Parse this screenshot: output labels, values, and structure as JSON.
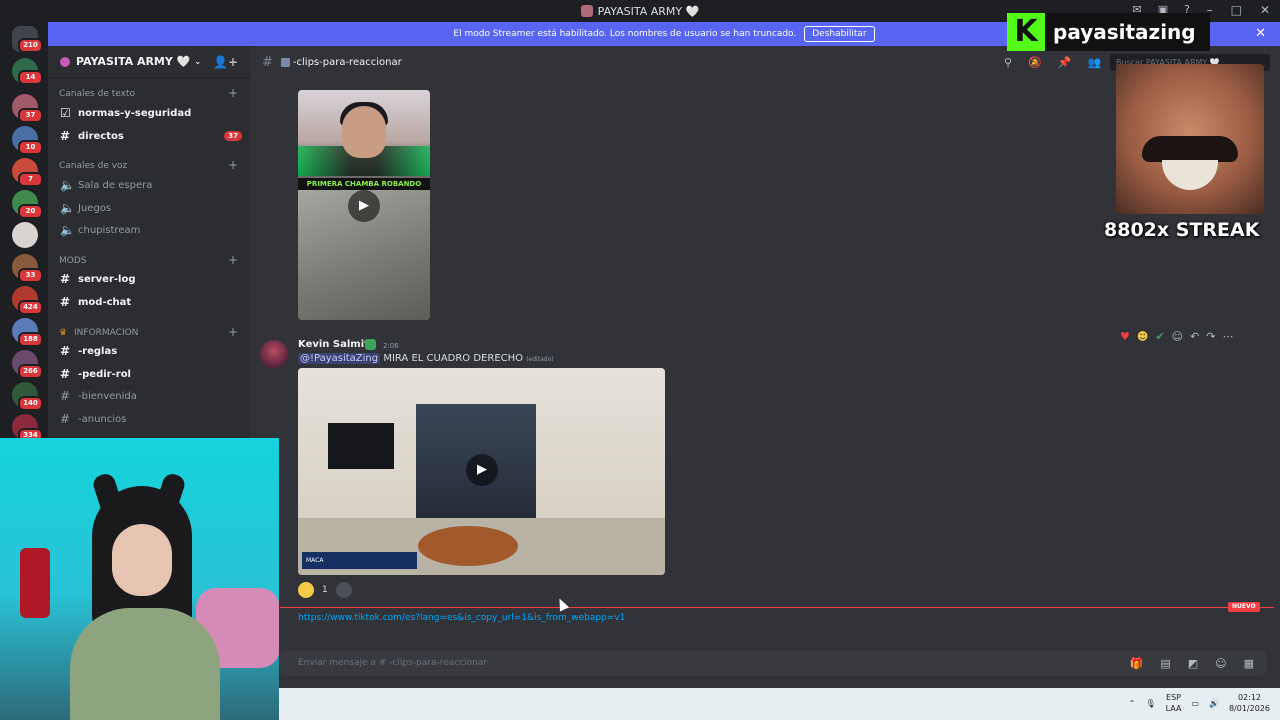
{
  "window": {
    "title": "PAYASITA ARMY 🤍"
  },
  "banner": {
    "text": "El modo Streamer está habilitado. Los nombres de usuario se han truncado.",
    "button": "Deshabilitar"
  },
  "servers": [
    {
      "badge": "210"
    },
    {
      "badge": "14"
    },
    {
      "badge": "37"
    },
    {
      "badge": "10"
    },
    {
      "badge": "7"
    },
    {
      "badge": "20"
    },
    {
      "badge": ""
    },
    {
      "badge": "33"
    },
    {
      "badge": "424"
    },
    {
      "badge": "188"
    },
    {
      "badge": "266"
    },
    {
      "badge": "140"
    },
    {
      "badge": "334"
    }
  ],
  "sidebar": {
    "guild_name": "PAYASITA ARMY 🤍",
    "categories": {
      "text": "Canales de texto",
      "voice": "Canales de voz",
      "mods": "MODS",
      "info": "INFORMACION"
    },
    "channels": [
      {
        "name": "normas-y-seguridad",
        "bright": true
      },
      {
        "name": "directos",
        "bright": true,
        "mentions": "37"
      },
      {
        "name": "Sala de espera"
      },
      {
        "name": "Juegos"
      },
      {
        "name": "chupistream"
      },
      {
        "name": "server-log",
        "bright": true
      },
      {
        "name": "mod-chat",
        "bright": true
      },
      {
        "name": "-reglas",
        "bright": true
      },
      {
        "name": "-pedir-rol",
        "bright": true
      },
      {
        "name": "-bienvenida"
      },
      {
        "name": "-anuncios"
      }
    ]
  },
  "chat": {
    "channel_name": "-clips-para-reaccionar",
    "search_placeholder": "Buscar PAYASITA ARMY 🤍",
    "clip1_caption": "PRIMERA CHAMBA ROBANDO",
    "message": {
      "author": "Kevin Salmita",
      "time": "2:06",
      "mention": "@!PayasitaZing",
      "text": "MIRA EL CUADRO DERECHO",
      "edited": "(editado)",
      "clip_logo": "MACA",
      "reaction_count": "1"
    },
    "new_label": "NUEVO",
    "link": "https://www.tiktok.com/es?lang=es&is_copy_url=1&is_from_webapp=v1",
    "composer_placeholder": "Enviar mensaje a # -clips-para-reaccionar"
  },
  "taskbar": {
    "lang_top": "ESP",
    "lang_bottom": "LAA",
    "time": "02:12",
    "date": "8/01/2026"
  },
  "overlay": {
    "kick_letter": "K",
    "kick_name": "payasitazing",
    "streak": "8802x STREAK"
  },
  "colors": {
    "accent": "#5865f2",
    "mention_badge": "#da373c",
    "kick_green": "#53fc18",
    "link": "#00a8fc"
  }
}
